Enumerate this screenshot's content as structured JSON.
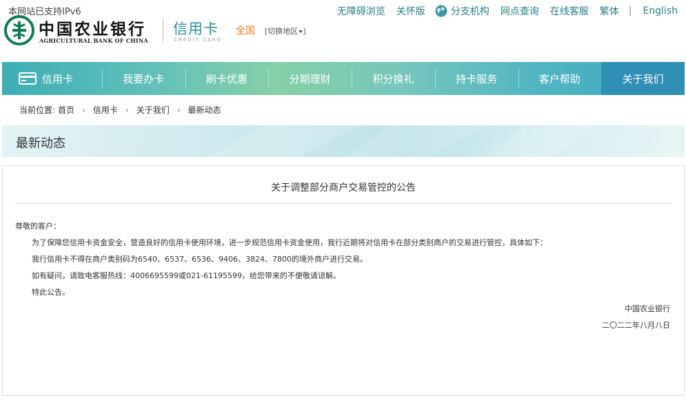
{
  "header": {
    "ipv6": "本网站已支持IPv6",
    "bank_cn": "中国农业银行",
    "bank_en": "AGRICULTURAL BANK OF CHINA",
    "card_cn": "信用卡",
    "card_en": "CREDIT  CARD",
    "region": "全国",
    "switch_region": "[切换地区"
  },
  "toplinks": {
    "accessible": "无障碍浏览",
    "care": "关怀版",
    "branches": "分支机构",
    "outlets": "网点查询",
    "online_service": "在线客服",
    "traditional": "繁体",
    "separator": "|",
    "english": "English"
  },
  "nav": {
    "brand": "信用卡",
    "items": [
      "我要办卡",
      "刷卡优惠",
      "分期理财",
      "积分换礼",
      "持卡服务",
      "客户帮助",
      "关于我们"
    ],
    "active_index": 6
  },
  "breadcrumb": {
    "lead": "当前位置:",
    "items": [
      "首页",
      "信用卡",
      "关于我们",
      "最新动态"
    ]
  },
  "section": {
    "title": "最新动态"
  },
  "article": {
    "title": "关于调整部分商户交易管控的公告",
    "greeting": "尊敬的客户：",
    "paragraphs": [
      "为了保障您信用卡资金安全，营造良好的信用卡使用环境，进一步规范信用卡资金使用，我行近期将对信用卡在部分类别商户的交易进行管控，具体如下：",
      "我行信用卡不得在商户类别码为6540、6537、6536、9406、3824、7800的境外商户进行交易。",
      "如有疑问，请致电客服热线：4006695599或021-61195599，给您带来的不便敬请谅解。",
      "特此公告。"
    ],
    "signature": "中国农业银行",
    "date": "二〇二二年八月八日"
  },
  "colors": {
    "brand_teal": "#2a8f98",
    "region_orange": "#ee7a1f",
    "nav_active": "#2f8fb5",
    "logo_green": "#0f7a55"
  }
}
